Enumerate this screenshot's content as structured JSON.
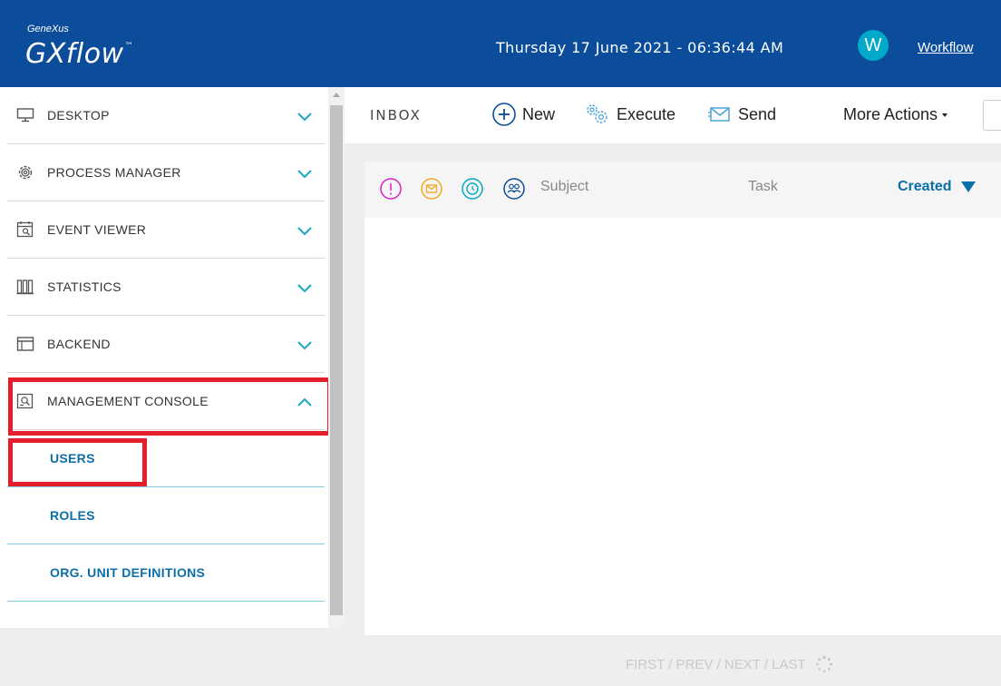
{
  "header": {
    "brand_small": "GeneXus",
    "brand_main": "GXflow",
    "brand_tm": "™",
    "datetime": "Thursday 17 June 2021 - 06:36:44 AM",
    "avatar_letter": "W",
    "user_link": "Workflow"
  },
  "sidebar": {
    "items": [
      {
        "label": "DESKTOP",
        "icon": "monitor-icon"
      },
      {
        "label": "PROCESS MANAGER",
        "icon": "gear-icon"
      },
      {
        "label": "EVENT VIEWER",
        "icon": "calendar-search-icon"
      },
      {
        "label": "STATISTICS",
        "icon": "bar-chart-icon"
      },
      {
        "label": "BACKEND",
        "icon": "window-icon"
      },
      {
        "label": "MANAGEMENT CONSOLE",
        "icon": "console-search-icon",
        "expanded": true
      }
    ],
    "subitems": [
      {
        "label": "USERS"
      },
      {
        "label": "ROLES"
      },
      {
        "label": "ORG. UNIT DEFINITIONS"
      }
    ]
  },
  "toolbar": {
    "title": "INBOX",
    "new_label": "New",
    "execute_label": "Execute",
    "send_label": "Send",
    "more_actions_label": "More Actions"
  },
  "grid": {
    "columns": {
      "subject": "Subject",
      "task": "Task",
      "created": "Created"
    }
  },
  "pager": {
    "text": "FIRST / PREV / NEXT / LAST"
  },
  "colors": {
    "header_bg": "#0b4d9a",
    "accent": "#00a9c9",
    "link_blue": "#0b6fa8",
    "highlight": "#e61e2b"
  }
}
